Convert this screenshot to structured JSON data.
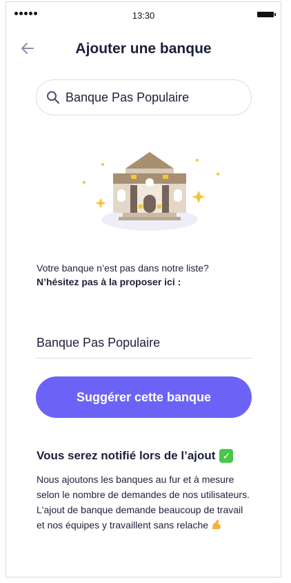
{
  "status_bar": {
    "time": "13:30"
  },
  "header": {
    "title": "Ajouter une banque"
  },
  "search": {
    "value": "Banque Pas Populaire"
  },
  "info": {
    "line1": "Votre banque n’est pas dans notre liste?",
    "line2": "N’hésitez pas à la proposer ici :"
  },
  "bank_field": {
    "value": "Banque Pas Populaire"
  },
  "cta": {
    "label": "Suggérer cette banque"
  },
  "notify": {
    "title": "Vous serez notifié lors de l’ajout",
    "body": "Nous ajoutons les banques au fur et à mesure selon le nombre de demandes de nos utilisateurs. L'ajout de banque demande beaucoup de travail et nos équipes y travaillent sans relache"
  },
  "icons": [
    "back-arrow-icon",
    "search-icon",
    "bank-building-icon",
    "check-mark-emoji-icon",
    "flexed-bicep-emoji-icon"
  ],
  "colors": {
    "accent": "#6c63f6",
    "text": "#1c1f3a",
    "check": "#48c74a"
  }
}
